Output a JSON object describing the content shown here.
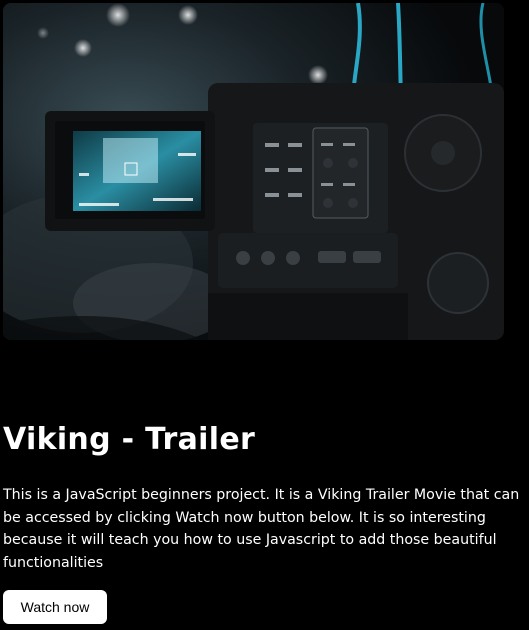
{
  "hero": {
    "image_subject": "camcorder-filming-concert"
  },
  "title": "Viking - Trailer",
  "description": "This is a JavaScript beginners project. It is a Viking Trailer Movie that can be accessed by clicking Watch now button below. It is so interesting because it will teach you how to use Javascript to add those beautiful functionalities",
  "watch_button": {
    "label": "Watch now"
  },
  "colors": {
    "background": "#000000",
    "text": "#ffffff",
    "button_background": "#ffffff",
    "button_text": "#000000",
    "accent_teal": "#38b8d0"
  }
}
